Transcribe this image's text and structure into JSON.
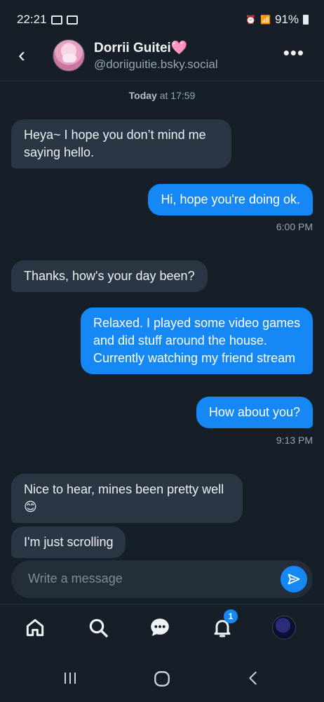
{
  "status": {
    "time": "22:21",
    "battery": "91%"
  },
  "header": {
    "name": "Dorrii Guitei",
    "heart": "🩷",
    "handle": "@doriiguitie.bsky.social"
  },
  "chat": {
    "day_bold": "Today",
    "day_rest": " at 17:59",
    "messages": [
      {
        "text": "Heya~ I hope you don’t mind me saying hello."
      },
      {
        "text": "Hi, hope you're doing ok."
      },
      {
        "text": "Thanks, how's your day been?"
      },
      {
        "text": "Relaxed. I played some video games and did stuff around the house. Currently watching my friend stream"
      },
      {
        "text": "How about you?"
      },
      {
        "text": "Nice to hear, mines been pretty well 😊"
      },
      {
        "text": "I'm just scrolling"
      }
    ],
    "times": [
      "6:00 PM",
      "9:13 PM"
    ]
  },
  "composer": {
    "placeholder": "Write a message"
  },
  "tabbar": {
    "notifications_badge": "1"
  }
}
